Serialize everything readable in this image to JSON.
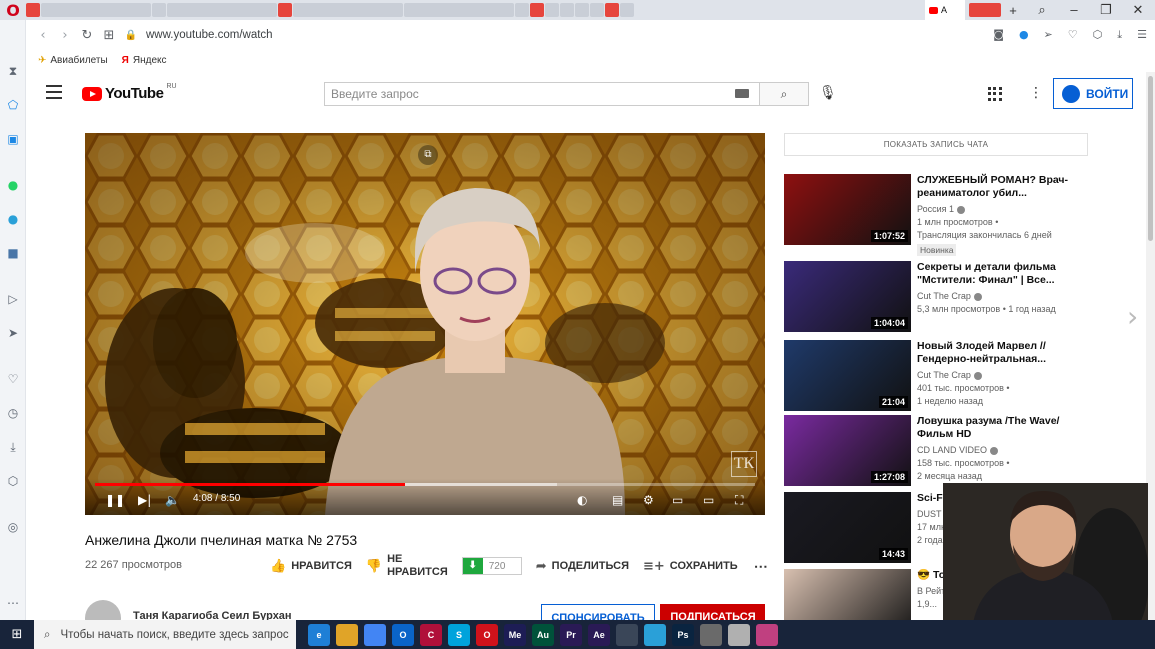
{
  "browser": {
    "active_tab_label": "А",
    "url": "www.youtube.com/watch",
    "bookmarks": [
      {
        "icon": "plane-icon",
        "label": "Авиабилеты"
      },
      {
        "icon": "yandex-icon",
        "label": "Яндекс"
      }
    ]
  },
  "youtube": {
    "logo_text": "YouTube",
    "logo_region": "RU",
    "search_placeholder": "Введите запрос",
    "signin_label": "ВОЙТИ"
  },
  "player": {
    "current_time": "4:08",
    "duration": "8:50",
    "progress_fraction": 0.47,
    "watermark": "ТК"
  },
  "video": {
    "title": "Анжелина Джоли пчелиная матка № 2753",
    "views": "22 267 просмотров",
    "like_label": "НРАВИТСЯ",
    "dislike_line1": "НЕ",
    "dislike_line2": "НРАВИТСЯ",
    "download_quality": "720",
    "share_label": "ПОДЕЛИТЬСЯ",
    "save_label": "СОХРАНИТЬ",
    "channel_name": "Таня Карагиоба Сеил Бурхан",
    "sponsor_label": "СПОНСИРОВАТЬ",
    "subscribe_label": "ПОДПИСАТЬСЯ"
  },
  "sidebar": {
    "chat_button": "ПОКАЗАТЬ ЗАПИСЬ ЧАТА",
    "recommendations": [
      {
        "title": "СЛУЖЕБНЫЙ РОМАН? Врач-реаниматолог убил...",
        "channel": "Россия 1",
        "views": "1 млн просмотров •",
        "age": "Трансляция закончилась 6 дней",
        "badge": "Новинка",
        "duration": "1:07:52",
        "thumb_color": "#8e1010"
      },
      {
        "title": "Секреты и детали фильма \"Мстители: Финал\" | Все...",
        "channel": "Cut The Crap",
        "views": "5,3 млн просмотров • 1 год назад",
        "age": "",
        "badge": "",
        "duration": "1:04:04",
        "thumb_color": "#3a2a7a"
      },
      {
        "title": "Новый Злодей Марвел // Гендерно-нейтральная...",
        "channel": "Cut The Crap",
        "views": "401 тыс. просмотров •",
        "age": "1 неделю назад",
        "badge": "",
        "duration": "21:04",
        "thumb_color": "#1f3a6a"
      },
      {
        "title": "Ловушка разума /The Wave/ Фильм HD",
        "channel": "CD LAND VIDEO",
        "views": "158 тыс. просмотров •",
        "age": "2 месяца назад",
        "badge": "",
        "duration": "1:27:08",
        "thumb_color": "#7a2aa0"
      },
      {
        "title": "Sci-Fi Short Film \"FTL\"",
        "channel": "DUST",
        "views": "17 млн просмотров •",
        "age": "2 года назад",
        "badge": "",
        "duration": "14:43",
        "thumb_color": "#1a1a22"
      },
      {
        "title": "😎 Топ... комеди...",
        "channel": "В Рейт...",
        "views": "1,9...",
        "age": "",
        "badge": "",
        "duration": "",
        "thumb_color": "#d8c0b0"
      }
    ]
  },
  "taskbar": {
    "search_placeholder": "Чтобы начать поиск, введите здесь запрос",
    "apps": [
      {
        "name": "edge",
        "label": "e",
        "color": "#1e7fd6"
      },
      {
        "name": "explorer",
        "label": "",
        "color": "#e0a428"
      },
      {
        "name": "chrome",
        "label": "",
        "color": "#4285f4"
      },
      {
        "name": "outlook",
        "label": "O",
        "color": "#0a64c8"
      },
      {
        "name": "app-c",
        "label": "C",
        "color": "#b0103a"
      },
      {
        "name": "skype",
        "label": "S",
        "color": "#00a3dc"
      },
      {
        "name": "opera",
        "label": "O",
        "color": "#d0121b"
      },
      {
        "name": "media-encoder",
        "label": "Me",
        "color": "#1d1d55"
      },
      {
        "name": "audition",
        "label": "Au",
        "color": "#00523a"
      },
      {
        "name": "premiere",
        "label": "Pr",
        "color": "#2a1a55"
      },
      {
        "name": "after-effects",
        "label": "Ae",
        "color": "#2a1a55"
      },
      {
        "name": "app-gear",
        "label": "",
        "color": "#3a4658"
      },
      {
        "name": "telegram",
        "label": "",
        "color": "#2aa0d8"
      },
      {
        "name": "photoshop",
        "label": "Ps",
        "color": "#0a2440"
      },
      {
        "name": "app-box",
        "label": "",
        "color": "#6a6a6a"
      },
      {
        "name": "app-wheel",
        "label": "",
        "color": "#b0b0b0"
      },
      {
        "name": "app-color",
        "label": "",
        "color": "#c04080"
      }
    ]
  }
}
